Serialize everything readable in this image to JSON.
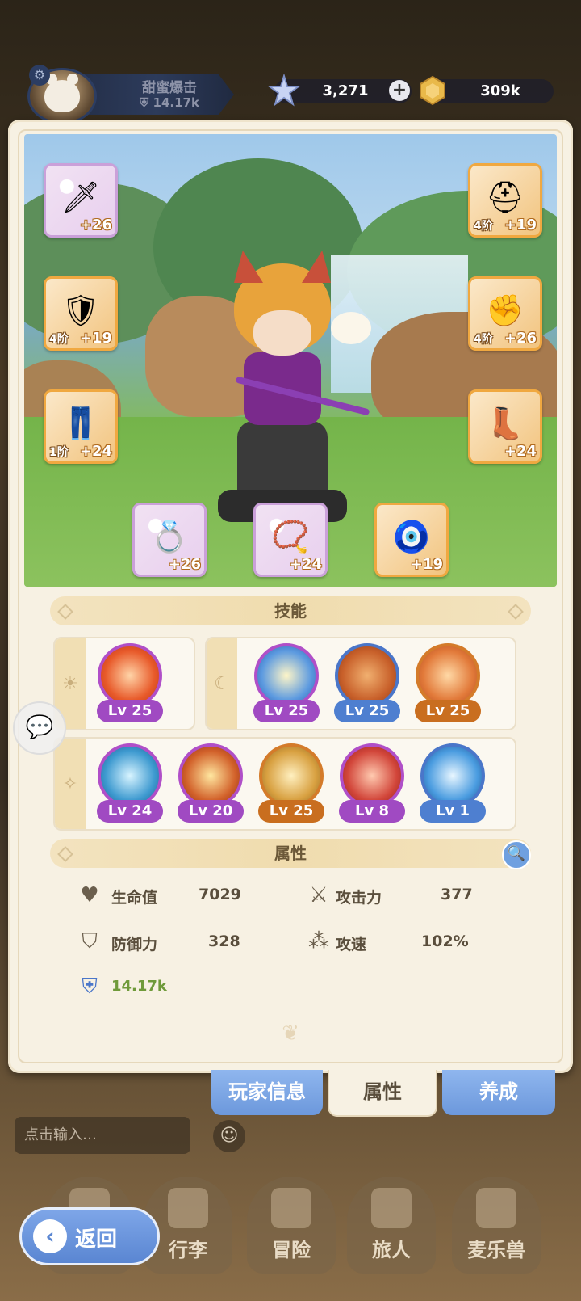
{
  "top_bar": {
    "guild_name": "甜蜜爆击",
    "guild_power": "14.17k",
    "gem_amount": "3,271",
    "coin_amount": "309k",
    "plus_icon": "+"
  },
  "equipment": {
    "weapon": {
      "level": "+26",
      "icon": "dagger-icon"
    },
    "helmet": {
      "tier": "4阶",
      "level": "+19",
      "icon": "helmet-icon"
    },
    "armor": {
      "tier": "4阶",
      "level": "+19",
      "icon": "armor-icon"
    },
    "gloves": {
      "tier": "4阶",
      "level": "+26",
      "icon": "gauntlet-icon"
    },
    "pants": {
      "tier": "1阶",
      "level": "+24",
      "icon": "pants-icon"
    },
    "boots": {
      "level": "+24",
      "icon": "boots-icon"
    },
    "ring": {
      "level": "+26",
      "icon": "ring-icon"
    },
    "necklace": {
      "level": "+24",
      "icon": "necklace-icon"
    },
    "amulet": {
      "level": "+19",
      "icon": "amulet-icon"
    }
  },
  "skills": {
    "title": "技能",
    "sun_group": [
      {
        "level": "Lv 25"
      }
    ],
    "moon_group": [
      {
        "level": "Lv 25"
      },
      {
        "level": "Lv 25"
      },
      {
        "level": "Lv 25"
      }
    ],
    "star_group": [
      {
        "level": "Lv 24"
      },
      {
        "level": "Lv 20"
      },
      {
        "level": "Lv 25"
      },
      {
        "level": "Lv 8"
      },
      {
        "level": "Lv 1"
      }
    ]
  },
  "attributes": {
    "title": "属性",
    "hp_label": "生命值",
    "hp_value": "7029",
    "atk_label": "攻击力",
    "atk_value": "377",
    "def_label": "防御力",
    "def_value": "328",
    "spd_label": "攻速",
    "spd_value": "102%",
    "power_value": "14.17k"
  },
  "tabs": {
    "player_info": "玩家信息",
    "attributes": "属性",
    "develop": "养成"
  },
  "chat": {
    "placeholder": "点击输入…"
  },
  "nav": {
    "back": "返回",
    "bag": "行李",
    "adventure": "冒险",
    "traveler": "旅人",
    "pet": "麦乐兽"
  },
  "colors": {
    "purple_quality": "#b04fc8",
    "blue_quality": "#4a76c9",
    "orange_quality": "#d47b2a",
    "power_green": "#6f9a3a"
  }
}
